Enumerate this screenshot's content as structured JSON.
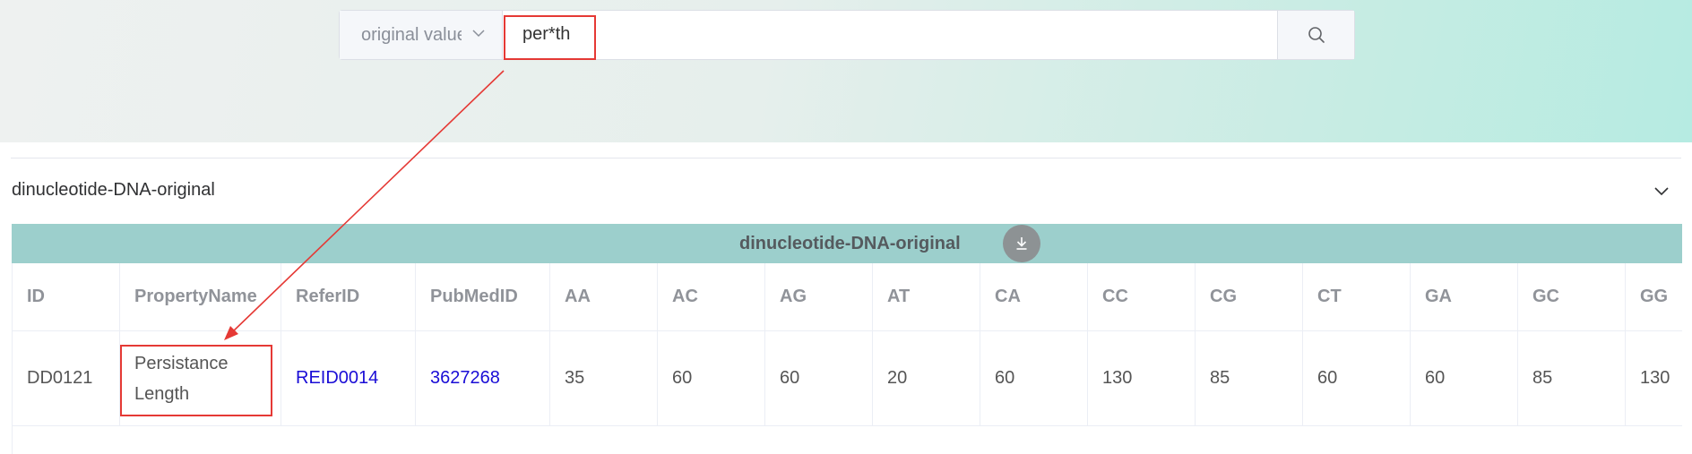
{
  "search": {
    "field_select": "original value",
    "query": "per*th"
  },
  "section": {
    "title": "dinucleotide-DNA-original"
  },
  "table": {
    "banner_title": "dinucleotide-DNA-original",
    "columns": [
      "ID",
      "PropertyName",
      "ReferID",
      "PubMedID",
      "AA",
      "AC",
      "AG",
      "AT",
      "CA",
      "CC",
      "CG",
      "CT",
      "GA",
      "GC",
      "GG"
    ],
    "rows": [
      [
        "DD0121",
        "Persistance Length",
        "REID0014",
        "3627268",
        "35",
        "60",
        "60",
        "20",
        "60",
        "130",
        "85",
        "60",
        "60",
        "85",
        "130"
      ]
    ]
  },
  "colors": {
    "highlight": "#e53935",
    "banner": "#9ccfcc",
    "link": "#1a0dd6"
  },
  "icons": {
    "select_chevron": "chevron-down-icon",
    "search": "search-icon",
    "download": "download-icon",
    "collapse": "chevron-down-icon"
  }
}
